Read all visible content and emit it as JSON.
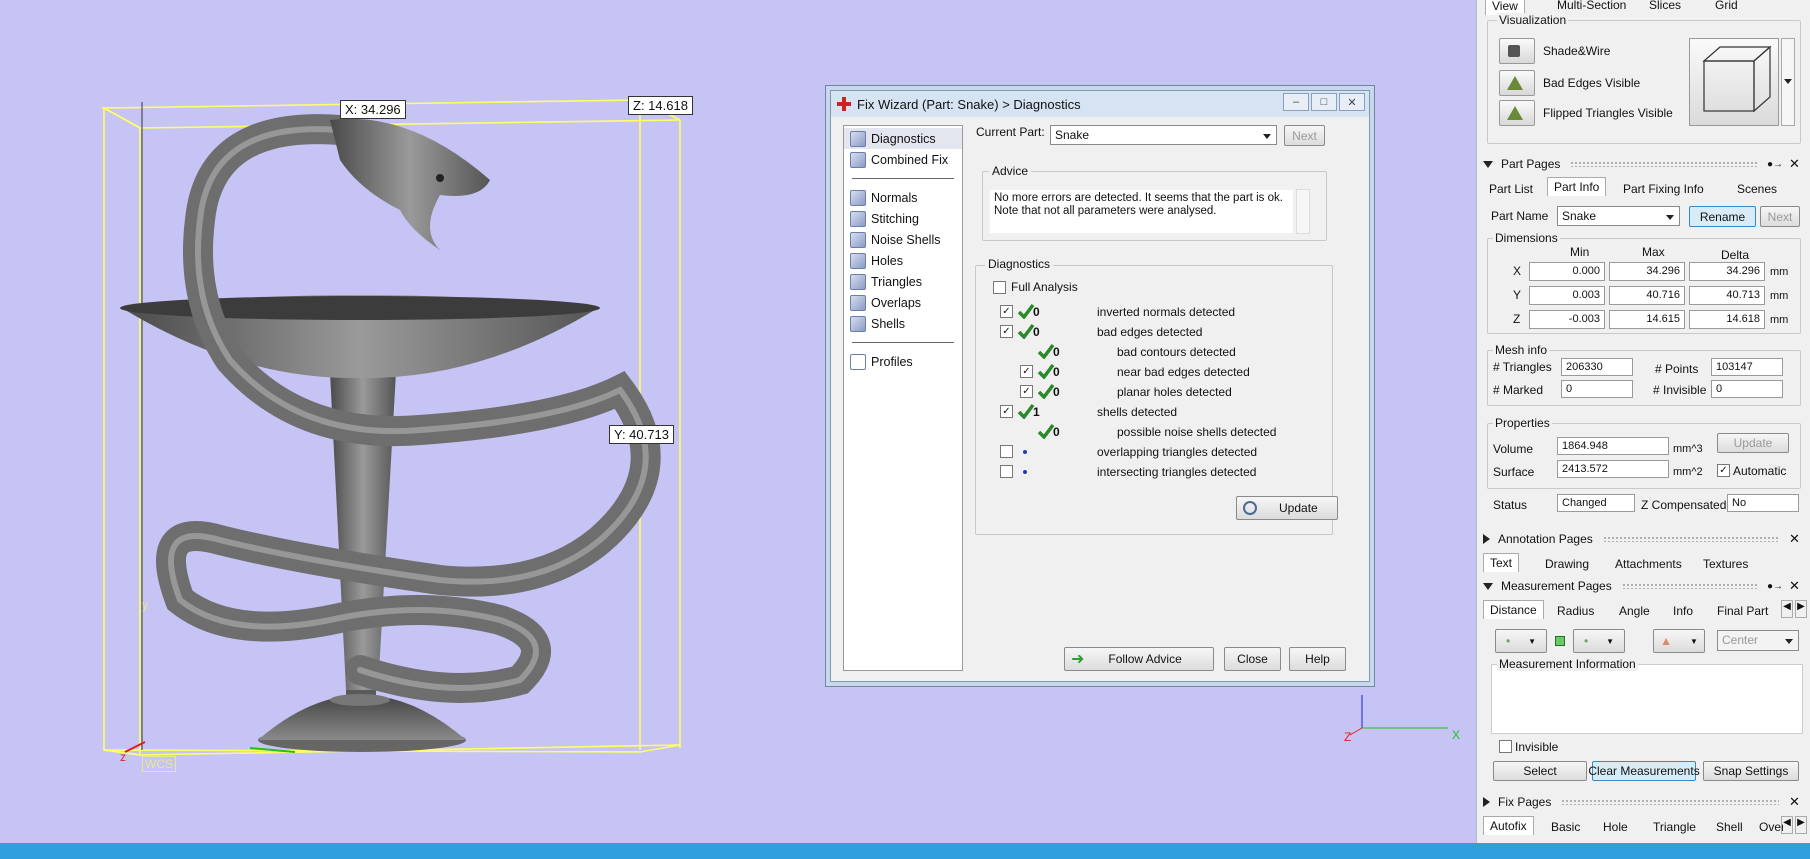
{
  "viewport": {
    "dim_x": "X: 34.296",
    "dim_z": "Z: 14.618",
    "dim_y": "Y: 40.713",
    "wcs_label": "WCS",
    "axis_z": "z",
    "axis_y": "y",
    "corner_axis_z": "Z",
    "corner_axis_x": "X"
  },
  "dialog": {
    "title": "Fix Wizard (Part: Snake) > Diagnostics",
    "nav_top": [
      "Diagnostics",
      "Combined Fix"
    ],
    "nav_mid": [
      "Normals",
      "Stitching",
      "Noise Shells",
      "Holes",
      "Triangles",
      "Overlaps",
      "Shells"
    ],
    "nav_bottom": [
      "Profiles"
    ],
    "current_part_label": "Current Part:",
    "current_part_value": "Snake",
    "next_button": "Next",
    "advice_label": "Advice",
    "advice_text": "No more errors are detected. It seems that the part is ok. Note that not all parameters were analysed.",
    "diagnostics_label": "Diagnostics",
    "full_analysis_label": "Full Analysis",
    "rows": [
      {
        "num": "0",
        "text": "inverted normals detected",
        "checked": true,
        "ok": true,
        "indent": 0
      },
      {
        "num": "0",
        "text": "bad edges detected",
        "checked": true,
        "ok": true,
        "indent": 0
      },
      {
        "num": "0",
        "text": "bad contours detected",
        "checked": false,
        "ok": true,
        "indent": 2
      },
      {
        "num": "0",
        "text": "near bad edges detected",
        "checked": true,
        "ok": true,
        "indent": 1
      },
      {
        "num": "0",
        "text": "planar holes detected",
        "checked": true,
        "ok": true,
        "indent": 1
      },
      {
        "num": "1",
        "text": "shells detected",
        "checked": true,
        "ok": true,
        "indent": 0
      },
      {
        "num": "0",
        "text": "possible noise shells detected",
        "checked": false,
        "ok": true,
        "indent": 2
      },
      {
        "num": "",
        "text": "overlapping triangles detected",
        "checked": false,
        "ok": false,
        "indent": 0
      },
      {
        "num": "",
        "text": "intersecting triangles detected",
        "checked": false,
        "ok": false,
        "indent": 0
      }
    ],
    "update_button": "Update",
    "follow_advice_button": "Follow Advice",
    "close_button": "Close",
    "help_button": "Help"
  },
  "panel": {
    "top_tabs": [
      "View",
      "Multi-Section",
      "Slices",
      "Grid"
    ],
    "visualization_label": "Visualization",
    "vis_items": [
      "Shade&Wire",
      "Bad Edges Visible",
      "Flipped Triangles Visible"
    ],
    "part_pages_title": "Part Pages",
    "part_tabs": [
      "Part List",
      "Part Info",
      "Part Fixing Info",
      "Scenes"
    ],
    "part_name_label": "Part Name",
    "part_name_value": "Snake",
    "rename_button": "Rename",
    "next_button": "Next",
    "dimensions_label": "Dimensions",
    "dim_headers": [
      "Min",
      "Max",
      "Delta"
    ],
    "dim_rows": [
      {
        "axis": "X",
        "min": "0.000",
        "max": "34.296",
        "delta": "34.296",
        "unit": "mm"
      },
      {
        "axis": "Y",
        "min": "0.003",
        "max": "40.716",
        "delta": "40.713",
        "unit": "mm"
      },
      {
        "axis": "Z",
        "min": "-0.003",
        "max": "14.615",
        "delta": "14.618",
        "unit": "mm"
      }
    ],
    "mesh_info_label": "Mesh info",
    "triangles_label": "# Triangles",
    "triangles_value": "206330",
    "points_label": "# Points",
    "points_value": "103147",
    "marked_label": "# Marked",
    "marked_value": "0",
    "invisible_label": "# Invisible",
    "invisible_value": "0",
    "properties_label": "Properties",
    "volume_label": "Volume",
    "volume_value": "1864.948",
    "volume_unit": "mm^3",
    "surface_label": "Surface",
    "surface_value": "2413.572",
    "surface_unit": "mm^2",
    "update_button": "Update",
    "automatic_label": "Automatic",
    "status_label": "Status",
    "status_value": "Changed",
    "zcomp_label": "Z Compensated",
    "zcomp_value": "No",
    "annotation_title": "Annotation Pages",
    "annotation_tabs": [
      "Text",
      "Drawing",
      "Attachments",
      "Textures"
    ],
    "measurement_title": "Measurement Pages",
    "measurement_tabs": [
      "Distance",
      "Radius",
      "Angle",
      "Info",
      "Final Part"
    ],
    "center_combo": "Center",
    "measurement_info_label": "Measurement Information",
    "invisible_check_label": "Invisible",
    "select_button": "Select",
    "clear_button": "Clear Measurements",
    "snap_button": "Snap Settings",
    "fix_title": "Fix Pages",
    "fix_tabs": [
      "Autofix",
      "Basic",
      "Hole",
      "Triangle",
      "Shell",
      "Over"
    ]
  }
}
